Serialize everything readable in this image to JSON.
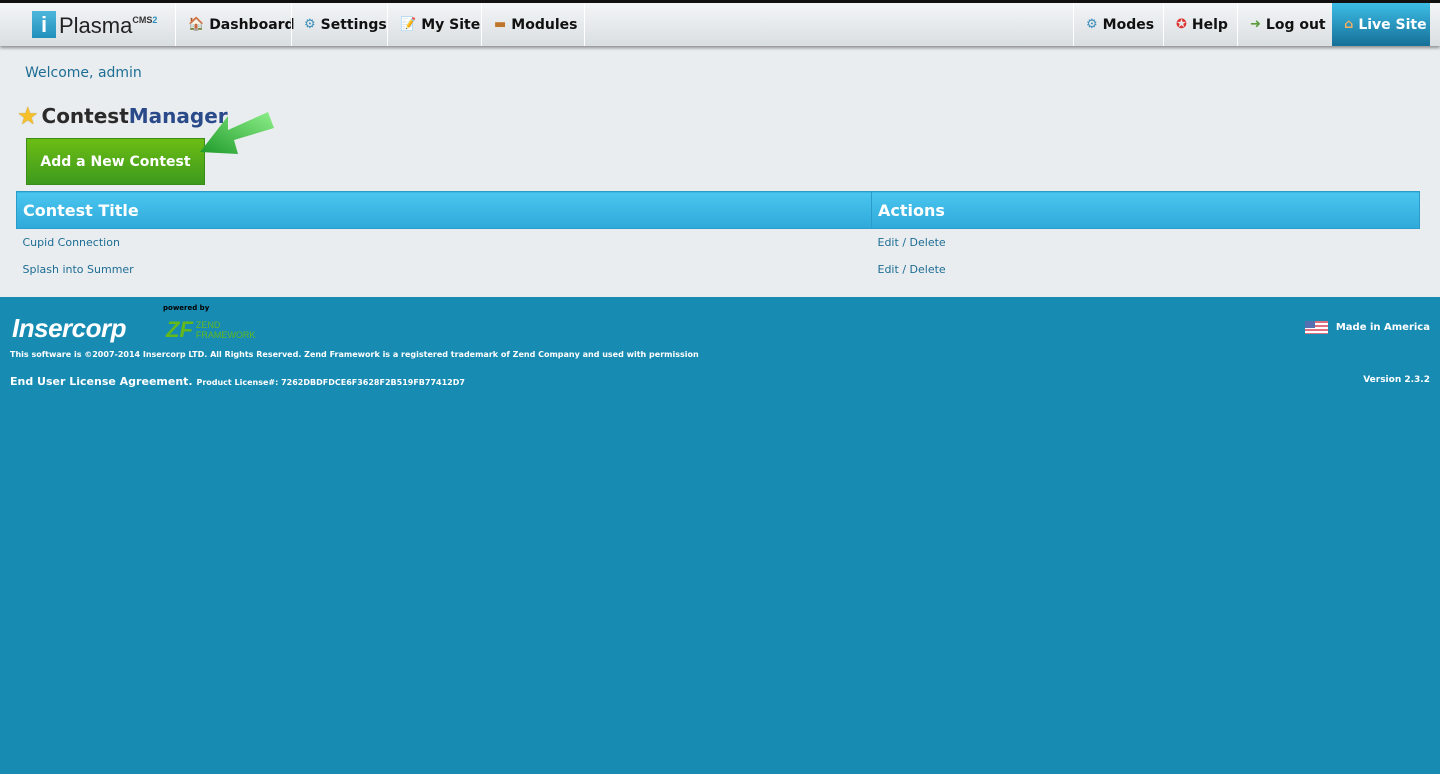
{
  "header": {
    "logo_i": "i",
    "logo_name": "Plasma",
    "logo_cms": "CMS",
    "logo_ver": "2",
    "nav_left": [
      {
        "label": "Dashboard",
        "icon": "dashboard-icon"
      },
      {
        "label": "Settings",
        "icon": "gear-icon"
      },
      {
        "label": "My Site",
        "icon": "edit-icon"
      },
      {
        "label": "Modules",
        "icon": "box-icon"
      }
    ],
    "nav_right": [
      {
        "label": "Modes",
        "icon": "gears-icon"
      },
      {
        "label": "Help",
        "icon": "lifebuoy-icon"
      },
      {
        "label": "Log out",
        "icon": "door-icon"
      },
      {
        "label": "Live Site",
        "icon": "home-icon"
      }
    ]
  },
  "main": {
    "welcome": "Welcome, admin",
    "title_a": "Contest",
    "title_b": "Manager",
    "add_button": "Add a New Contest",
    "columns": [
      "Contest Title",
      "Actions"
    ],
    "rows": [
      {
        "title": "Cupid Connection",
        "edit": "Edit",
        "sep": "/",
        "delete": "Delete"
      },
      {
        "title": "Splash into Summer",
        "edit": "Edit",
        "sep": "/",
        "delete": "Delete"
      }
    ]
  },
  "footer": {
    "brand": "Insercorp",
    "powered_by": "powered by",
    "zf_mark": "ZF",
    "zf_text1": "ZEND",
    "zf_text2": "FRAMEWORK",
    "copyright": "This software is ©2007-2014 Insercorp LTD. All Rights Reserved. Zend Framework is a registered trademark of Zend Company and used with permission",
    "eula": "End User License Agreement.",
    "license": "Product License#: 7262DBDFDCE6F3628F2B519FB77412D7",
    "made": "Made in America",
    "version": "Version 2.3.2"
  },
  "colors": {
    "footer_bg": "#188bb3",
    "content_bg": "#e9edef",
    "header_table": "#3fb9e8",
    "add_button": "#52a819"
  }
}
